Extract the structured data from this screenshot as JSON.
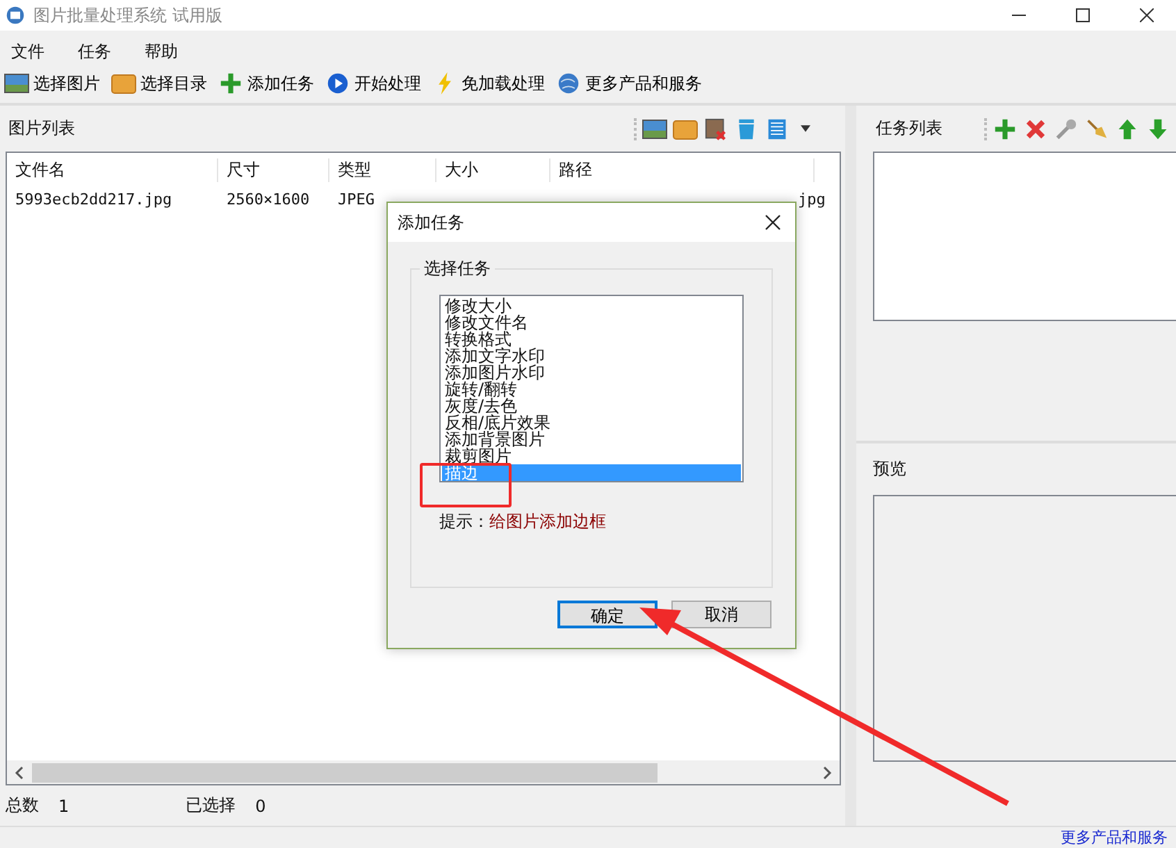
{
  "window": {
    "title": "图片批量处理系统 试用版"
  },
  "menu": [
    "文件",
    "任务",
    "帮助"
  ],
  "toolbar": [
    {
      "label": "选择图片",
      "kind": "picture"
    },
    {
      "label": "选择目录",
      "kind": "folder"
    },
    {
      "label": "添加任务",
      "kind": "add"
    },
    {
      "label": "开始处理",
      "kind": "play"
    },
    {
      "label": "免加载处理",
      "kind": "bolt"
    },
    {
      "label": "更多产品和服务",
      "kind": "globe"
    }
  ],
  "image_list": {
    "title": "图片列表",
    "columns": [
      "文件名",
      "尺寸",
      "类型",
      "大小",
      "路径"
    ],
    "rows": [
      {
        "cells": [
          "5993ecb2dd217.jpg",
          "2560×1600",
          "JPEG",
          "",
          "jpg"
        ]
      }
    ]
  },
  "status_bar": {
    "total_label": "总数",
    "total": "1",
    "selected_label": "已选择",
    "selected": "0"
  },
  "task_list": {
    "title": "任务列表"
  },
  "preview": {
    "title": "预览"
  },
  "dialog": {
    "title": "添加任务",
    "group": "选择任务",
    "tasks": [
      {
        "label": "修改大小",
        "selected": false
      },
      {
        "label": "修改文件名",
        "selected": false
      },
      {
        "label": "转换格式",
        "selected": false
      },
      {
        "label": "添加文字水印",
        "selected": false
      },
      {
        "label": "添加图片水印",
        "selected": false
      },
      {
        "label": "旋转/翻转",
        "selected": false
      },
      {
        "label": "灰度/去色",
        "selected": false
      },
      {
        "label": "反相/底片效果",
        "selected": false
      },
      {
        "label": "添加背景图片",
        "selected": false
      },
      {
        "label": "裁剪图片",
        "selected": false
      },
      {
        "label": "描边",
        "selected": true
      }
    ],
    "hint_label": "提示：",
    "hint": "给图片添加边框",
    "buttons": [
      {
        "label": "确定",
        "default": true
      },
      {
        "label": "取消",
        "default": false
      }
    ]
  },
  "footer_link": "更多产品和服务"
}
